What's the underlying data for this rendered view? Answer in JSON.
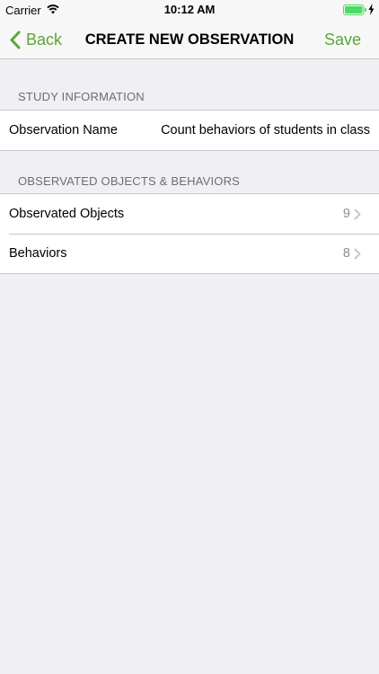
{
  "status_bar": {
    "carrier": "Carrier",
    "time": "10:12 AM",
    "icons": [
      "wifi-icon",
      "battery-icon",
      "charging-bolt-icon"
    ]
  },
  "nav": {
    "back_label": "Back",
    "title": "CREATE NEW OBSERVATION",
    "save_label": "Save",
    "accent_color": "#5aa63a"
  },
  "sections": {
    "study_info": {
      "header": "STUDY INFORMATION",
      "observation_name_label": "Observation Name",
      "observation_name_value": "Count behaviors of students in class"
    },
    "objects_behaviors": {
      "header": "OBSERVATED OBJECTS & BEHAVIORS",
      "rows": [
        {
          "label": "Observated Objects",
          "count": "9"
        },
        {
          "label": "Behaviors",
          "count": "8"
        }
      ]
    }
  }
}
